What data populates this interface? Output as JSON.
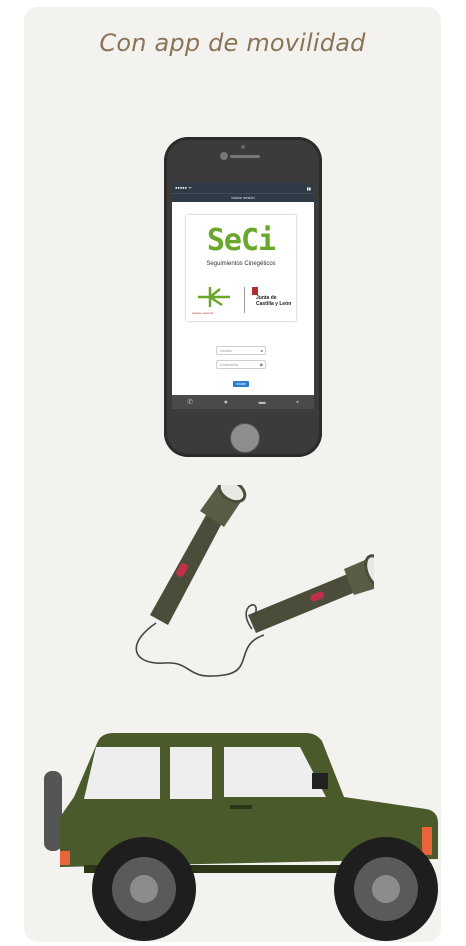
{
  "card": {
    "title": "Con app de movilidad"
  },
  "phone": {
    "status_left": "●●●●● ᯤ",
    "status_right": "▮▮",
    "screen_title": "Iniciar sesión",
    "app_logo": "SeCi",
    "app_subtitle": "Seguimientos Cinegéticos",
    "partner_left": "parque nacional",
    "partner_right_line1": "Junta de",
    "partner_right_line2": "Castilla y León",
    "username_placeholder": "Usuario",
    "password_placeholder": "Contraseña",
    "login_label": "Iniciar",
    "tabs": [
      "phone-icon",
      "circle-icon",
      "mail-icon",
      "briefcase-icon"
    ]
  },
  "colors": {
    "card_bg": "#f3f2ef",
    "title": "#8a7456",
    "seci_green": "#6aa82c",
    "login_blue": "#2d7bd0",
    "vehicle_green": "#4a5a2b"
  }
}
